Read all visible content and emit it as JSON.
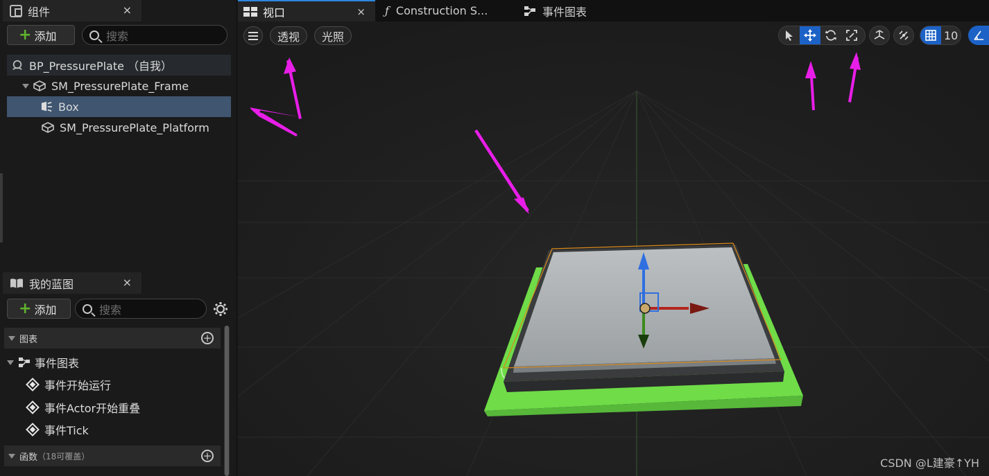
{
  "components_panel": {
    "title": "组件",
    "close": "×",
    "add_label": "添加",
    "search_placeholder": "搜索",
    "tree": [
      {
        "label": "BP_PressurePlate （自我）"
      },
      {
        "label": "SM_PressurePlate_Frame"
      },
      {
        "label": "Box"
      },
      {
        "label": "SM_PressurePlate_Platform"
      }
    ]
  },
  "blueprint_panel": {
    "title": "我的蓝图",
    "close": "×",
    "add_label": "添加",
    "search_placeholder": "搜索",
    "sections": [
      {
        "label": "图表",
        "add": "+"
      },
      {
        "label": "函数",
        "suffix": "（18可覆盖）",
        "add": "+"
      }
    ],
    "event_graph": "事件图表",
    "events": [
      "事件开始运行",
      "事件Actor开始重叠",
      "事件Tick"
    ]
  },
  "tabs": [
    {
      "label": "视口",
      "icon": "viewport-icon",
      "close": "×",
      "active": true
    },
    {
      "label": "Construction S...",
      "icon": "function-icon",
      "glyph": "ƒ"
    },
    {
      "label": "事件图表",
      "icon": "event-graph-icon"
    }
  ],
  "viewport": {
    "menu_icon": "hamburger-icon",
    "view_mode": "透视",
    "lighting": "光照",
    "grid_snap_value": "10",
    "watermark": "CSDN @L建豪↑YH"
  },
  "colors": {
    "selection_blue": "#1c62c6",
    "annotation_arrow": "#e81ee8",
    "plate_green": "#6fdc48",
    "plate_top": "#a4a8ab",
    "gizmo_x": "#b3261e",
    "gizmo_y": "#3d8a1e",
    "gizmo_z": "#2f6fe0"
  }
}
